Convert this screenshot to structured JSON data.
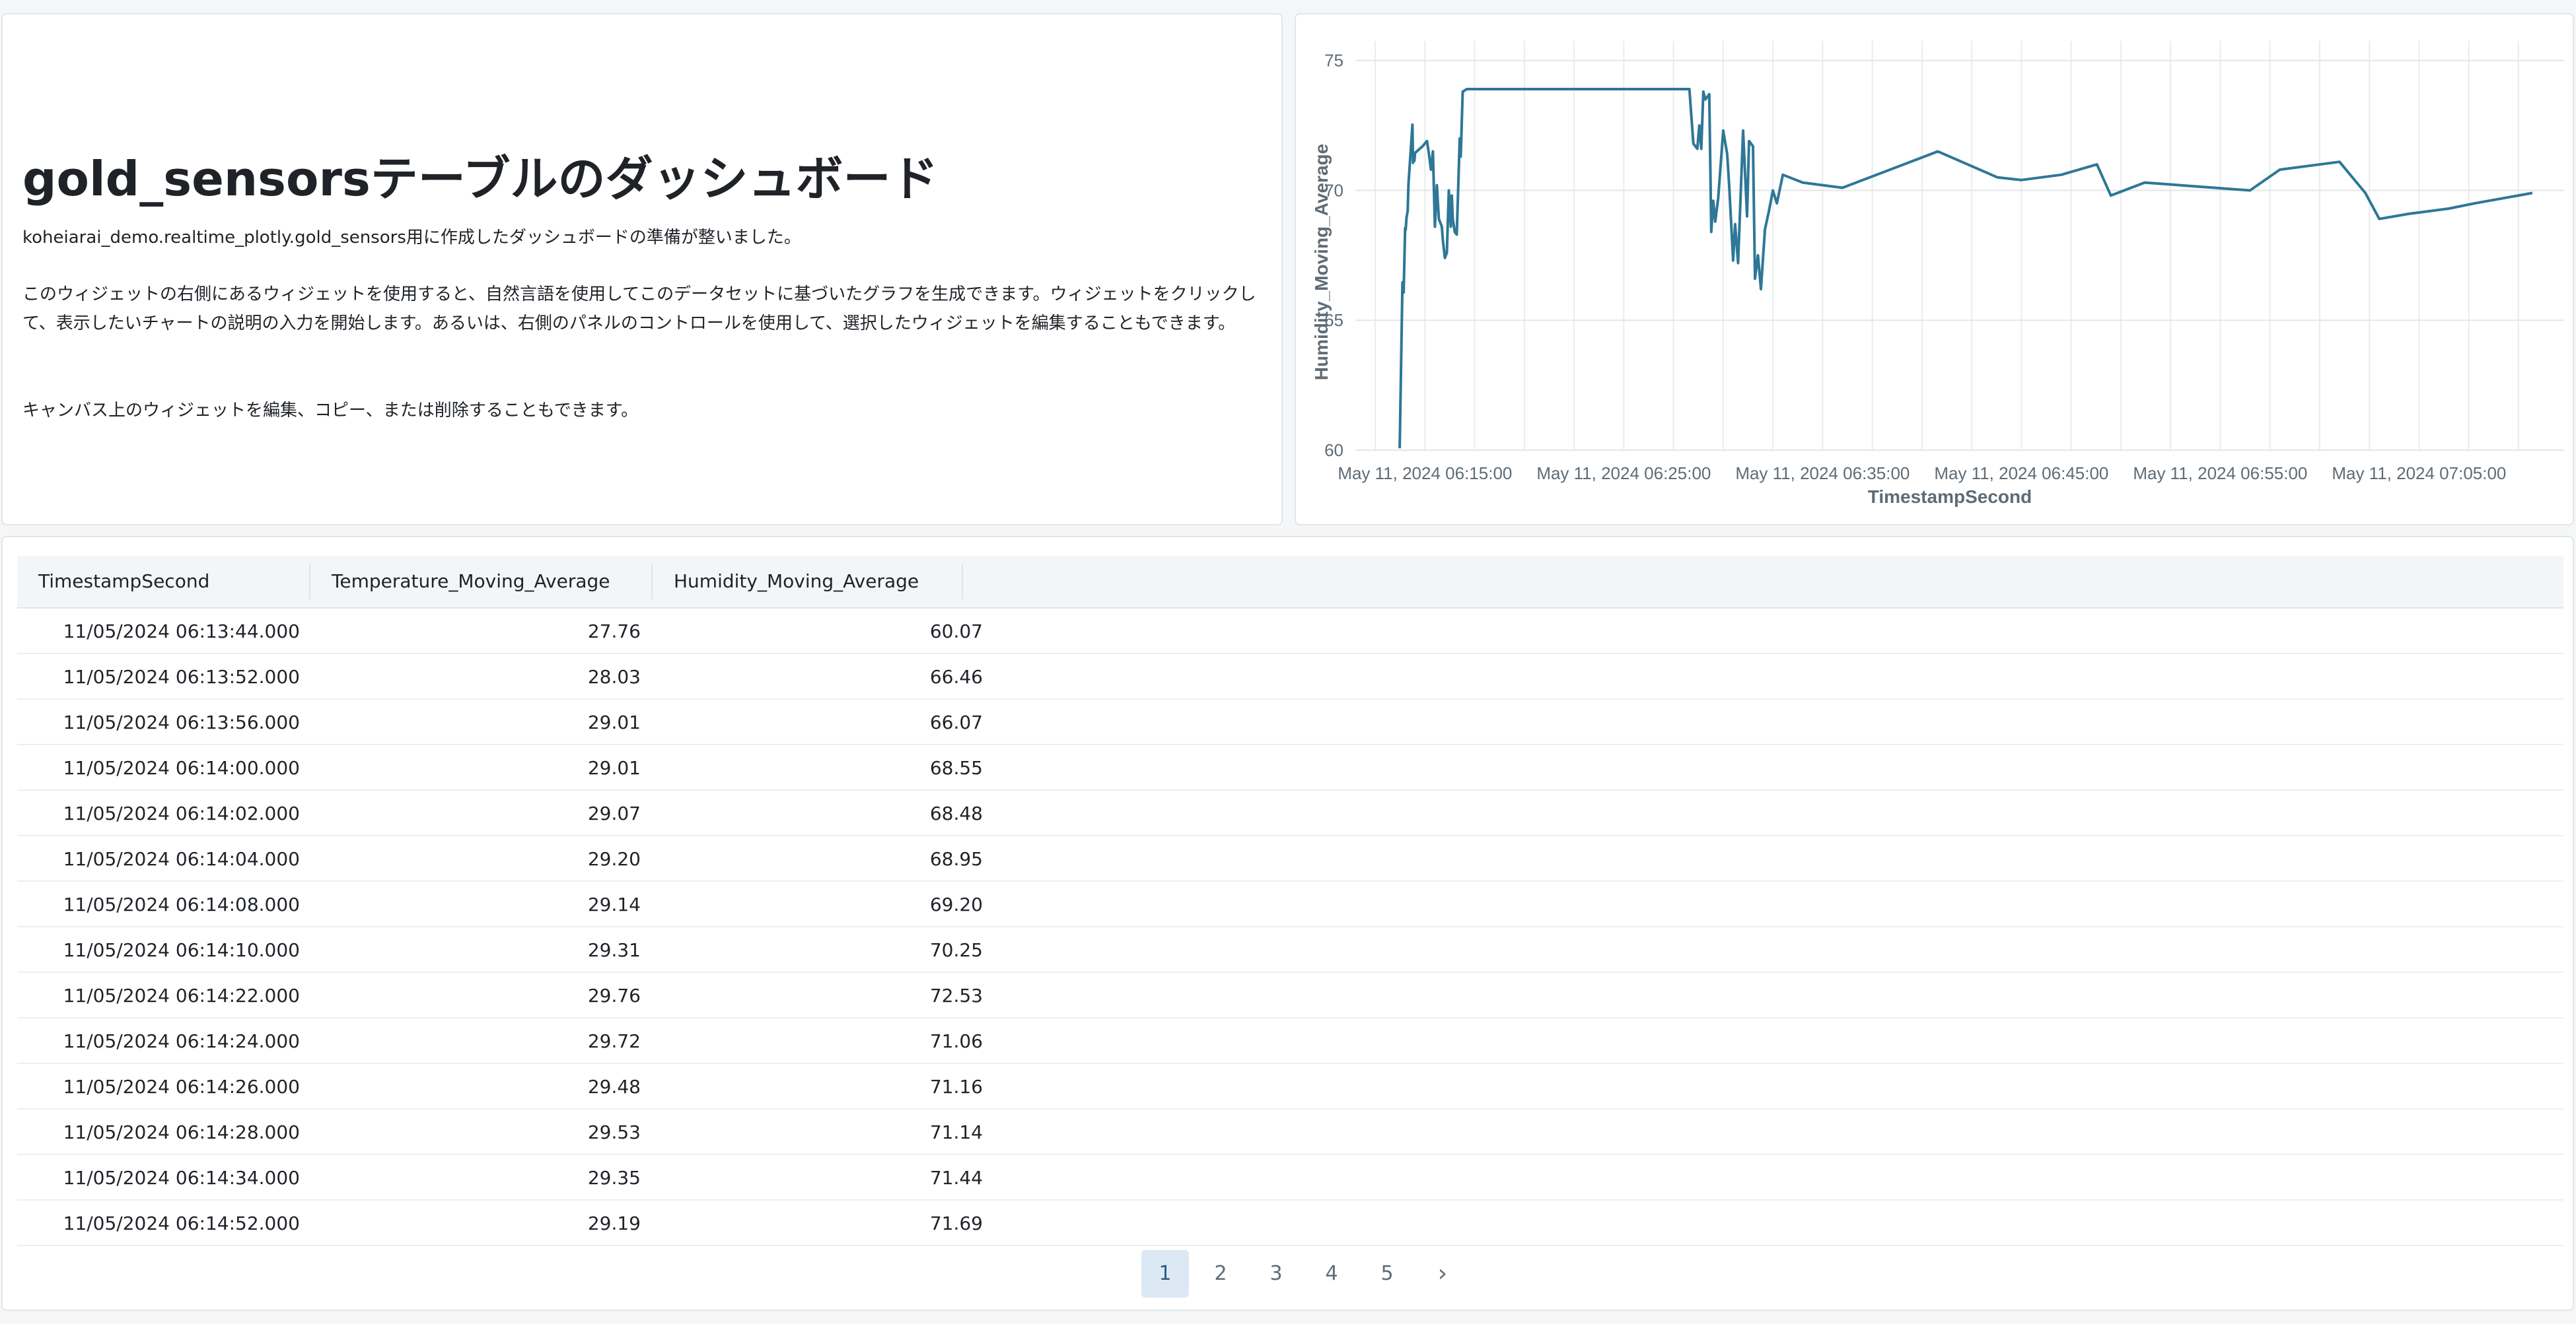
{
  "text_widget": {
    "title": "gold_sensorsテーブルのダッシュボード",
    "para1": "koheiarai_demo.realtime_plotly.gold_sensors用に作成したダッシュボードの準備が整いました。",
    "para2": "このウィジェットの右側にあるウィジェットを使用すると、自然言語を使用してこのデータセットに基づいたグラフを生成できます。ウィジェットをクリックして、表示したいチャートの説明の入力を開始します。あるいは、右側のパネルのコントロールを使用して、選択したウィジェットを編集することもできます。",
    "para3": "キャンバス上のウィジェットを編集、コピー、または削除することもできます。"
  },
  "chart_data": {
    "type": "line",
    "xlabel": "TimestampSecond",
    "ylabel": "Humidity_Moving_Average",
    "ylim": [
      60,
      75.5
    ],
    "yticks": [
      60,
      65,
      70,
      75
    ],
    "xticks": [
      "May 11, 2024 06:15:00",
      "May 11, 2024 06:25:00",
      "May 11, 2024 06:35:00",
      "May 11, 2024 06:45:00",
      "May 11, 2024 06:55:00",
      "May 11, 2024 07:05:00"
    ],
    "x_unit": "minutes past 06:00 on May 11, 2024",
    "grid": true,
    "color": "#2e7797",
    "series": [
      {
        "x": [
          13.73,
          13.87,
          13.93,
          14.0,
          14.03,
          14.07,
          14.13,
          14.17,
          14.37,
          14.4,
          14.43,
          14.47,
          14.5,
          14.87,
          15.1,
          15.2,
          15.3,
          15.4,
          15.5,
          15.6,
          15.7,
          15.85,
          15.9,
          16.0,
          16.1,
          16.2,
          16.3,
          16.35,
          16.4,
          16.5,
          16.6,
          16.75,
          16.8,
          16.9,
          17.1,
          17.2,
          17.3,
          17.5,
          17.7,
          28.3,
          28.5,
          28.7,
          28.8,
          28.9,
          29.0,
          29.1,
          29.3,
          29.4,
          29.5,
          29.6,
          29.75,
          30.0,
          30.2,
          30.3,
          30.5,
          30.6,
          30.75,
          31.0,
          31.2,
          31.3,
          31.5,
          31.6,
          31.75,
          31.9,
          32.1,
          32.3,
          32.5,
          32.7,
          33.0,
          34.0,
          36.0,
          40.8,
          43.8,
          45.0,
          47.0,
          48.8,
          49.5,
          51.2,
          56.5,
          58.0,
          61.0,
          62.3,
          63.0,
          64.5,
          66.5,
          67.8,
          70.7
        ],
        "y": [
          60.07,
          66.46,
          66.07,
          68.55,
          68.48,
          68.95,
          69.2,
          70.25,
          72.53,
          71.06,
          71.16,
          71.14,
          71.44,
          71.69,
          71.9,
          71.4,
          70.8,
          71.5,
          68.6,
          70.2,
          68.9,
          68.6,
          68.1,
          67.4,
          67.6,
          70.0,
          68.6,
          69.8,
          68.9,
          68.4,
          68.3,
          72.0,
          71.3,
          73.8,
          73.9,
          73.9,
          73.9,
          73.9,
          73.9,
          73.9,
          71.8,
          71.6,
          72.5,
          71.6,
          73.8,
          73.5,
          73.7,
          68.4,
          69.6,
          68.8,
          69.7,
          72.3,
          71.4,
          70.2,
          67.3,
          68.7,
          67.2,
          72.3,
          69.0,
          71.9,
          71.7,
          66.6,
          67.5,
          66.2,
          68.5,
          69.2,
          70.0,
          69.5,
          70.6,
          70.3,
          70.1,
          71.5,
          70.5,
          70.4,
          70.6,
          71.0,
          69.8,
          70.3,
          70.0,
          70.8,
          71.1,
          69.9,
          68.9,
          69.1,
          69.3,
          69.5,
          69.9
        ]
      }
    ]
  },
  "table": {
    "columns": [
      "TimestampSecond",
      "Temperature_Moving_Average",
      "Humidity_Moving_Average"
    ],
    "rows": [
      [
        "11/05/2024 06:13:44.000",
        "27.76",
        "60.07"
      ],
      [
        "11/05/2024 06:13:52.000",
        "28.03",
        "66.46"
      ],
      [
        "11/05/2024 06:13:56.000",
        "29.01",
        "66.07"
      ],
      [
        "11/05/2024 06:14:00.000",
        "29.01",
        "68.55"
      ],
      [
        "11/05/2024 06:14:02.000",
        "29.07",
        "68.48"
      ],
      [
        "11/05/2024 06:14:04.000",
        "29.20",
        "68.95"
      ],
      [
        "11/05/2024 06:14:08.000",
        "29.14",
        "69.20"
      ],
      [
        "11/05/2024 06:14:10.000",
        "29.31",
        "70.25"
      ],
      [
        "11/05/2024 06:14:22.000",
        "29.76",
        "72.53"
      ],
      [
        "11/05/2024 06:14:24.000",
        "29.72",
        "71.06"
      ],
      [
        "11/05/2024 06:14:26.000",
        "29.48",
        "71.16"
      ],
      [
        "11/05/2024 06:14:28.000",
        "29.53",
        "71.14"
      ],
      [
        "11/05/2024 06:14:34.000",
        "29.35",
        "71.44"
      ],
      [
        "11/05/2024 06:14:52.000",
        "29.19",
        "71.69"
      ]
    ]
  },
  "pagination": {
    "pages": [
      "1",
      "2",
      "3",
      "4",
      "5"
    ],
    "current": "1",
    "next_icon": "chevron-right-icon",
    "next_glyph": "›"
  }
}
